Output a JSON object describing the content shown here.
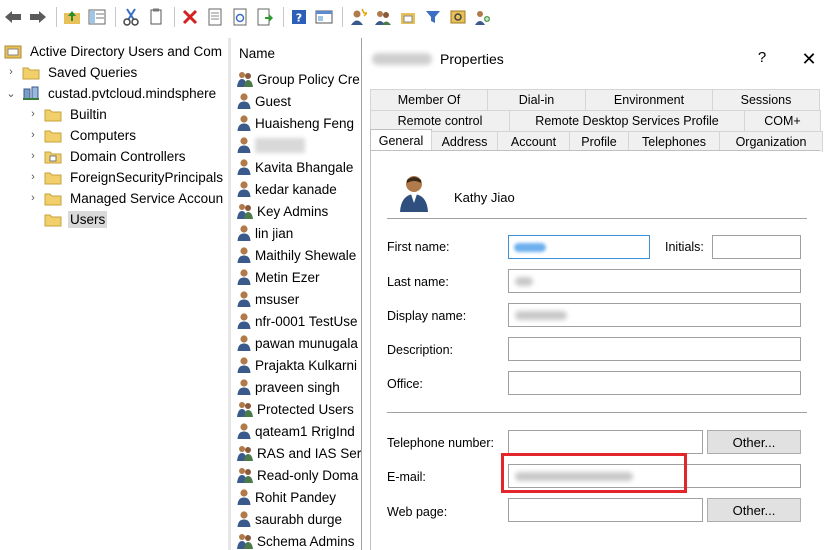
{
  "toolbar": {
    "icons": [
      "back-icon",
      "forward-icon",
      "up-folder-icon",
      "show-hide-tree-icon",
      "cut-icon",
      "copy-icon",
      "delete-icon",
      "properties-icon",
      "refresh-icon",
      "export-icon",
      "help-icon",
      "console-icon",
      "new-user-icon",
      "new-group-icon",
      "new-ou-icon",
      "filter-icon",
      "find-icon",
      "add-to-group-icon"
    ]
  },
  "tree": {
    "items": [
      {
        "label": "Active Directory Users and Com",
        "level": 0,
        "expander": ""
      },
      {
        "label": "Saved Queries",
        "level": 1,
        "expander": "›"
      },
      {
        "label": "custad.pvtcloud.mindsphere",
        "level": 1,
        "expander": "⌄"
      },
      {
        "label": "Builtin",
        "level": 2,
        "expander": "›"
      },
      {
        "label": "Computers",
        "level": 2,
        "expander": "›"
      },
      {
        "label": "Domain Controllers",
        "level": 2,
        "expander": "›"
      },
      {
        "label": "ForeignSecurityPrincipals",
        "level": 2,
        "expander": "›"
      },
      {
        "label": "Managed Service Accoun",
        "level": 2,
        "expander": "›"
      },
      {
        "label": "Users",
        "level": 2,
        "expander": "",
        "selected": true
      }
    ]
  },
  "list": {
    "header": "Name",
    "items": [
      {
        "label": "Group Policy Cre",
        "type": "group"
      },
      {
        "label": "Guest",
        "type": "user"
      },
      {
        "label": "Huaisheng Feng",
        "type": "user"
      },
      {
        "label": "",
        "type": "user",
        "selected": true
      },
      {
        "label": "Kavita Bhangale",
        "type": "user"
      },
      {
        "label": "kedar kanade",
        "type": "user"
      },
      {
        "label": "Key Admins",
        "type": "group"
      },
      {
        "label": "lin jian",
        "type": "user"
      },
      {
        "label": "Maithily Shewale",
        "type": "user"
      },
      {
        "label": "Metin Ezer",
        "type": "user"
      },
      {
        "label": "msuser",
        "type": "user"
      },
      {
        "label": "nfr-0001 TestUse",
        "type": "user"
      },
      {
        "label": "pawan munugala",
        "type": "user"
      },
      {
        "label": "Prajakta Kulkarni",
        "type": "user"
      },
      {
        "label": "praveen singh",
        "type": "user"
      },
      {
        "label": "Protected Users",
        "type": "group"
      },
      {
        "label": "qateam1 RrigInd",
        "type": "user"
      },
      {
        "label": "RAS and IAS Serv",
        "type": "group"
      },
      {
        "label": "Read-only Doma",
        "type": "group"
      },
      {
        "label": "Rohit Pandey",
        "type": "user"
      },
      {
        "label": "saurabh durge",
        "type": "user"
      },
      {
        "label": "Schema Admins",
        "type": "group"
      }
    ]
  },
  "dialog": {
    "title": "Properties",
    "help": "?",
    "close": "✕",
    "tabs_row1": [
      "Member Of",
      "Dial-in",
      "Environment",
      "Sessions"
    ],
    "tabs_row2": [
      "Remote control",
      "Remote Desktop Services Profile",
      "COM+"
    ],
    "tabs_row3": [
      "General",
      "Address",
      "Account",
      "Profile",
      "Telephones",
      "Organization"
    ],
    "active_tab": "General",
    "user_name": "Kathy Jiao",
    "fields": {
      "first_name": "First name:",
      "initials": "Initials:",
      "last_name": "Last name:",
      "display_name": "Display name:",
      "description": "Description:",
      "office": "Office:",
      "telephone": "Telephone number:",
      "email": "E-mail:",
      "webpage": "Web page:"
    },
    "other_label": "Other...",
    "highlight_color": "#e2262b"
  }
}
